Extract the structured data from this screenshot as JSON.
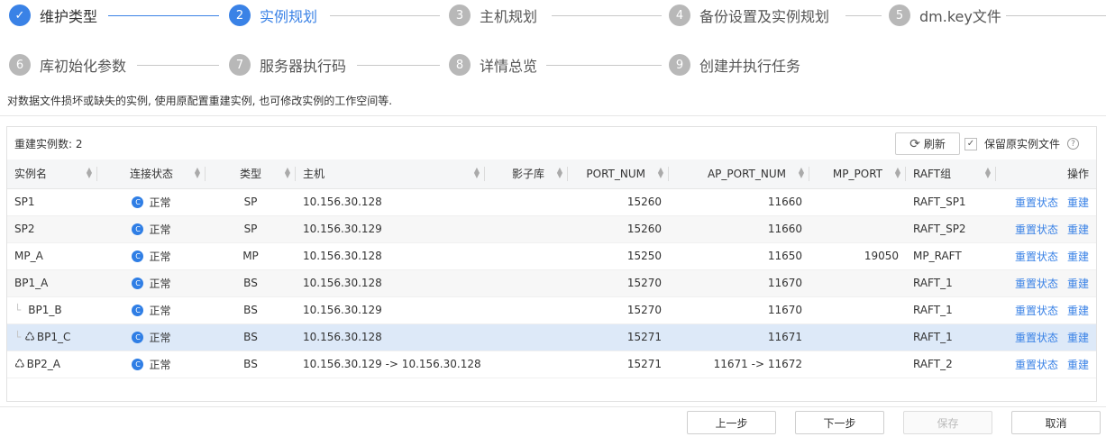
{
  "wizard": {
    "steps": [
      {
        "num": "✓",
        "label": "维护类型",
        "state": "done"
      },
      {
        "num": "2",
        "label": "实例规划",
        "state": "active"
      },
      {
        "num": "3",
        "label": "主机规划",
        "state": "todo"
      },
      {
        "num": "4",
        "label": "备份设置及实例规划",
        "state": "todo"
      },
      {
        "num": "5",
        "label": "dm.key文件",
        "state": "todo"
      },
      {
        "num": "6",
        "label": "库初始化参数",
        "state": "todo"
      },
      {
        "num": "7",
        "label": "服务器执行码",
        "state": "todo"
      },
      {
        "num": "8",
        "label": "详情总览",
        "state": "todo"
      },
      {
        "num": "9",
        "label": "创建并执行任务",
        "state": "todo"
      }
    ]
  },
  "description": "对数据文件损坏或缺失的实例, 使用原配置重建实例, 也可修改实例的工作空间等.",
  "panel": {
    "count_label": "重建实例数: 2",
    "refresh_label": "刷新",
    "keep_label": "保留原实例文件",
    "keep_checked": true
  },
  "table": {
    "headers": [
      "实例名",
      "连接状态",
      "类型",
      "主机",
      "影子库",
      "PORT_NUM",
      "AP_PORT_NUM",
      "MP_PORT",
      "RAFT组",
      "操作"
    ],
    "action_reset": "重置状态",
    "action_rebuild": "重建",
    "rows": [
      {
        "name": "SP1",
        "status": "正常",
        "type": "SP",
        "host": "10.156.30.128",
        "shadow": "",
        "port": "15260",
        "ap_port": "11660",
        "mp_port": "",
        "raft": "RAFT_SP1",
        "indent": 0,
        "icon": false
      },
      {
        "name": "SP2",
        "status": "正常",
        "type": "SP",
        "host": "10.156.30.129",
        "shadow": "",
        "port": "15260",
        "ap_port": "11660",
        "mp_port": "",
        "raft": "RAFT_SP2",
        "indent": 0,
        "icon": false
      },
      {
        "name": "MP_A",
        "status": "正常",
        "type": "MP",
        "host": "10.156.30.128",
        "shadow": "",
        "port": "15250",
        "ap_port": "11650",
        "mp_port": "19050",
        "raft": "MP_RAFT",
        "indent": 0,
        "icon": false
      },
      {
        "name": "BP1_A",
        "status": "正常",
        "type": "BS",
        "host": "10.156.30.128",
        "shadow": "",
        "port": "15270",
        "ap_port": "11670",
        "mp_port": "",
        "raft": "RAFT_1",
        "indent": 0,
        "icon": false
      },
      {
        "name": "BP1_B",
        "status": "正常",
        "type": "BS",
        "host": "10.156.30.129",
        "shadow": "",
        "port": "15270",
        "ap_port": "11670",
        "mp_port": "",
        "raft": "RAFT_1",
        "indent": 1,
        "icon": false
      },
      {
        "name": "BP1_C",
        "status": "正常",
        "type": "BS",
        "host": "10.156.30.128",
        "shadow": "",
        "port": "15271",
        "ap_port": "11671",
        "mp_port": "",
        "raft": "RAFT_1",
        "indent": 1,
        "icon": true
      },
      {
        "name": "BP2_A",
        "status": "正常",
        "type": "BS",
        "host": "10.156.30.129 -> 10.156.30.128",
        "shadow": "",
        "port": "15271",
        "ap_port": "11671 -> 11672",
        "mp_port": "",
        "raft": "RAFT_2",
        "indent": 0,
        "icon": true
      }
    ]
  },
  "footer": {
    "prev": "上一步",
    "next": "下一步",
    "save": "保存",
    "cancel": "取消"
  }
}
